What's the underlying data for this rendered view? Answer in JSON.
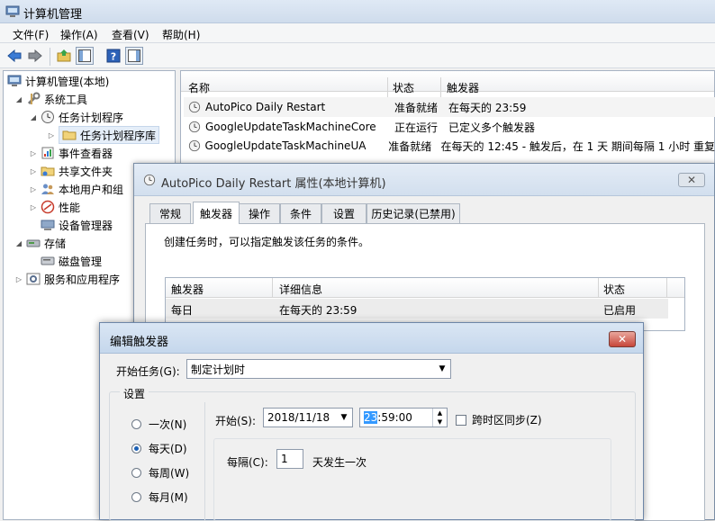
{
  "app": {
    "title": "计算机管理",
    "menu": [
      "文件(F)",
      "操作(A)",
      "查看(V)",
      "帮助(H)"
    ]
  },
  "tree": {
    "items": [
      {
        "label": "计算机管理(本地)",
        "icon": "computer-icon"
      },
      {
        "label": "系统工具",
        "icon": "tools-icon"
      },
      {
        "label": "任务计划程序",
        "icon": "clock-icon"
      },
      {
        "label": "任务计划程序库",
        "icon": "folder-icon"
      },
      {
        "label": "事件查看器",
        "icon": "event-viewer-icon"
      },
      {
        "label": "共享文件夹",
        "icon": "shared-folder-icon"
      },
      {
        "label": "本地用户和组",
        "icon": "users-icon"
      },
      {
        "label": "性能",
        "icon": "performance-icon"
      },
      {
        "label": "设备管理器",
        "icon": "device-manager-icon"
      },
      {
        "label": "存储",
        "icon": "storage-icon"
      },
      {
        "label": "磁盘管理",
        "icon": "disk-icon"
      },
      {
        "label": "服务和应用程序",
        "icon": "services-icon"
      }
    ]
  },
  "task_list": {
    "columns": [
      "名称",
      "状态",
      "触发器"
    ],
    "rows": [
      {
        "name": "AutoPico Daily Restart",
        "status": "准备就绪",
        "trigger": "在每天的 23:59"
      },
      {
        "name": "GoogleUpdateTaskMachineCore",
        "status": "正在运行",
        "trigger": "已定义多个触发器"
      },
      {
        "name": "GoogleUpdateTaskMachineUA",
        "status": "准备就绪",
        "trigger": "在每天的 12:45 - 触发后，在 1 天 期间每隔 1 小时 重复"
      }
    ]
  },
  "properties_dialog": {
    "title": "AutoPico Daily Restart 属性(本地计算机)",
    "tabs": [
      "常规",
      "触发器",
      "操作",
      "条件",
      "设置",
      "历史记录(已禁用)"
    ],
    "active_tab": "触发器",
    "description": "创建任务时，可以指定触发该任务的条件。",
    "grid_columns": [
      "触发器",
      "详细信息",
      "状态"
    ],
    "grid_rows": [
      {
        "trigger": "每日",
        "details": "在每天的 23:59",
        "status": "已启用"
      }
    ]
  },
  "edit_trigger_dialog": {
    "title": "编辑触发器",
    "begin_task_label": "开始任务(G):",
    "begin_task_value": "制定计划时",
    "settings_label": "设置",
    "schedule_options": [
      {
        "label": "一次(N)",
        "checked": false
      },
      {
        "label": "每天(D)",
        "checked": true
      },
      {
        "label": "每周(W)",
        "checked": false
      },
      {
        "label": "每月(M)",
        "checked": false
      }
    ],
    "start_label": "开始(S):",
    "start_date": "2018/11/18",
    "start_time_hour": "23",
    "start_time_rest": ":59:00",
    "sync_timezone_label": "跨时区同步(Z)",
    "recur_label": "每隔(C):",
    "recur_value": "1",
    "recur_suffix": "天发生一次"
  },
  "colors": {
    "accent": "#3399ff",
    "close_red": "#c7463a"
  }
}
